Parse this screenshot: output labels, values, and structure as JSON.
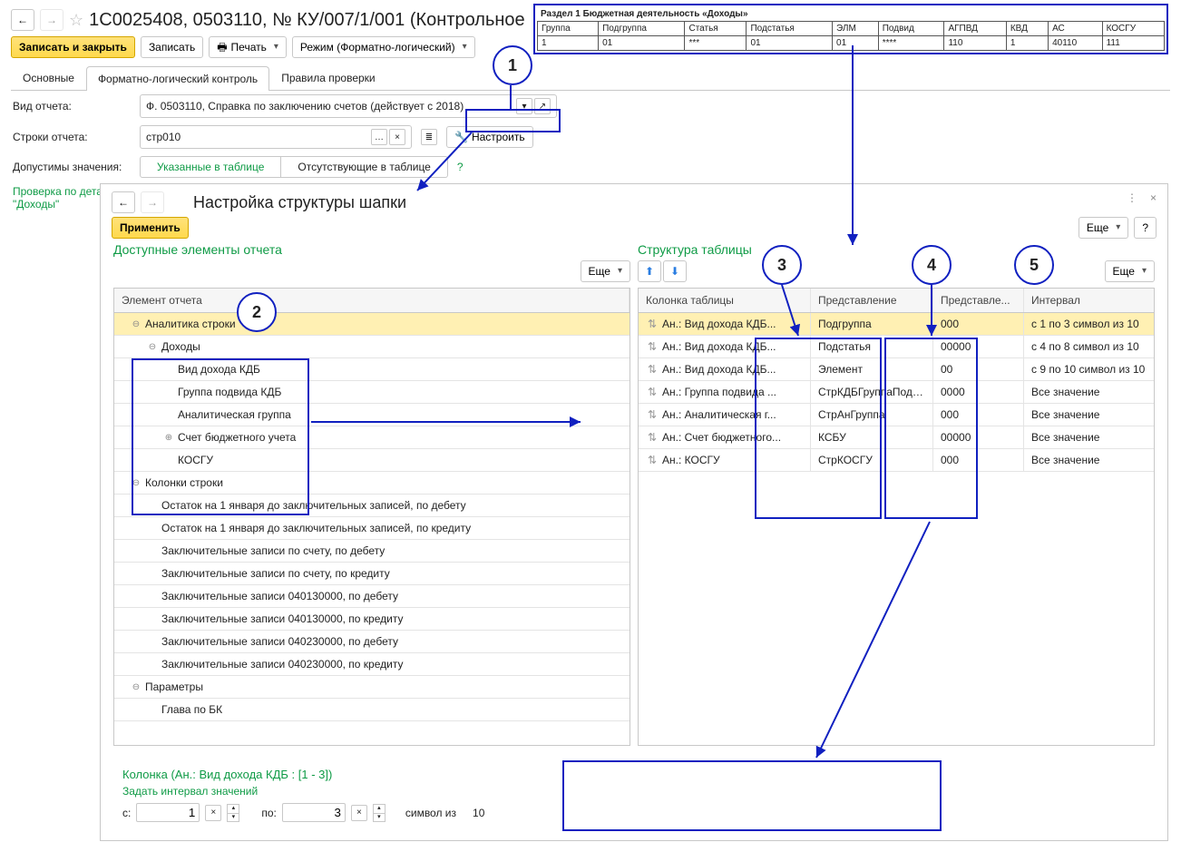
{
  "header": {
    "title": "1С0025408, 0503110, № КУ/007/1/001 (Контрольное",
    "save_close": "Записать и закрыть",
    "save": "Записать",
    "print": "Печать",
    "mode": "Режим (Форматно-логический)"
  },
  "tabs": {
    "main": "Основные",
    "fl": "Форматно-логический контроль",
    "rules": "Правила проверки"
  },
  "form": {
    "report_type_lbl": "Вид отчета:",
    "report_type_val": "Ф. 0503110, Справка по заключению счетов (действует с 2018)",
    "rows_lbl": "Строки отчета:",
    "rows_val": "стр010",
    "configure": "Настроить",
    "allowed_lbl": "Допустимы значения:",
    "allowed_a": "Указанные в таблице",
    "allowed_b": "Отсутствующие в таблице",
    "check_hint": "Проверка по детальным строкам группы раскрытия\n\"Доходы\""
  },
  "panel": {
    "title": "Настройка структуры шапки",
    "apply": "Применить",
    "more": "Еще",
    "left_title": "Доступные элементы отчета",
    "right_title": "Структура таблицы",
    "help": "?",
    "tree_header": "Элемент отчета",
    "grid_headers": {
      "c1": "Колонка таблицы",
      "c2": "Представление",
      "c3": "Представле...",
      "c4": "Интервал"
    }
  },
  "tree": [
    {
      "lvl": 1,
      "toggle": "⊖",
      "label": "Аналитика строки",
      "sel": true
    },
    {
      "lvl": 2,
      "toggle": "⊖",
      "label": "Доходы"
    },
    {
      "lvl": 3,
      "toggle": "",
      "label": "Вид дохода КДБ"
    },
    {
      "lvl": 3,
      "toggle": "",
      "label": "Группа подвида КДБ"
    },
    {
      "lvl": 3,
      "toggle": "",
      "label": "Аналитическая группа"
    },
    {
      "lvl": 3,
      "toggle": "⊕",
      "label": "Счет бюджетного учета"
    },
    {
      "lvl": 3,
      "toggle": "",
      "label": "КОСГУ"
    },
    {
      "lvl": 1,
      "toggle": "⊖",
      "label": "Колонки строки"
    },
    {
      "lvl": 2,
      "toggle": "",
      "label": "Остаток на 1 января до заключительных записей, по дебету"
    },
    {
      "lvl": 2,
      "toggle": "",
      "label": "Остаток на 1 января до заключительных записей, по кредиту"
    },
    {
      "lvl": 2,
      "toggle": "",
      "label": "Заключительные записи по счету, по дебету"
    },
    {
      "lvl": 2,
      "toggle": "",
      "label": "Заключительные записи по счету, по кредиту"
    },
    {
      "lvl": 2,
      "toggle": "",
      "label": "Заключительные записи 040130000, по дебету"
    },
    {
      "lvl": 2,
      "toggle": "",
      "label": "Заключительные записи 040130000, по кредиту"
    },
    {
      "lvl": 2,
      "toggle": "",
      "label": "Заключительные записи 040230000, по дебету"
    },
    {
      "lvl": 2,
      "toggle": "",
      "label": "Заключительные записи 040230000, по кредиту"
    },
    {
      "lvl": 1,
      "toggle": "⊖",
      "label": "Параметры"
    },
    {
      "lvl": 2,
      "toggle": "",
      "label": "Глава по БК"
    }
  ],
  "grid": [
    {
      "c1": "Ан.: Вид дохода КДБ...",
      "c2": "Подгруппа",
      "c3": "000",
      "c4": "с 1 по 3 символ из 10",
      "sel": true
    },
    {
      "c1": "Ан.: Вид дохода КДБ...",
      "c2": "Подстатья",
      "c3": "00000",
      "c4": "с 4 по 8 символ из 10"
    },
    {
      "c1": "Ан.: Вид дохода КДБ...",
      "c2": "Элемент",
      "c3": "00",
      "c4": "с 9 по 10 символ из 10"
    },
    {
      "c1": "Ан.: Группа подвида ...",
      "c2": "СтрКДБГруппаПодв...",
      "c3": "0000",
      "c4": "Все значение"
    },
    {
      "c1": "Ан.: Аналитическая г...",
      "c2": "СтрАнГруппа",
      "c3": "000",
      "c4": "Все значение"
    },
    {
      "c1": "Ан.: Счет бюджетного...",
      "c2": "КСБУ",
      "c3": "00000",
      "c4": "Все значение"
    },
    {
      "c1": "Ан.: КОСГУ",
      "c2": "СтрКОСГУ",
      "c3": "000",
      "c4": "Все значение"
    }
  ],
  "editor": {
    "title": "Колонка (Ан.: Вид дохода КДБ : [1 - 3])",
    "sub": "Задать интервал значений",
    "from_lbl": "с:",
    "from_val": "1",
    "to_lbl": "по:",
    "to_val": "3",
    "tail": "символ из",
    "total": "10"
  },
  "preview": {
    "caption": "Раздел 1 Бюджетная деятельность «Доходы»",
    "headers": [
      "Группа",
      "Подгруппа",
      "Статья",
      "Подстатья",
      "ЭЛМ",
      "Подвид",
      "АГПВД",
      "КВД",
      "АС",
      "КОСГУ"
    ],
    "row": [
      "1",
      "01",
      "***",
      "01",
      "01",
      "****",
      "110",
      "1",
      "40110",
      "111"
    ]
  },
  "callouts": {
    "1": "1",
    "2": "2",
    "3": "3",
    "4": "4",
    "5": "5"
  }
}
